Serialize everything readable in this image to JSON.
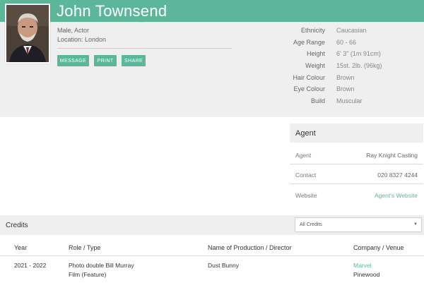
{
  "profile": {
    "name": "John Townsend",
    "gender_role": "Male, Actor",
    "location": "Location: London",
    "buttons": {
      "message": "MESSAGE",
      "print": "PRINT",
      "share": "SHARE"
    },
    "attributes": [
      {
        "label": "Ethnicity",
        "value": "Caucasian"
      },
      {
        "label": "Age Range",
        "value": "60 - 66"
      },
      {
        "label": "Height",
        "value": "6' 3\" (1m 91cm)"
      },
      {
        "label": "Weight",
        "value": "15st. 2lb. (96kg)"
      },
      {
        "label": "Hair Colour",
        "value": "Brown"
      },
      {
        "label": "Eye Colour",
        "value": "Brown"
      },
      {
        "label": "Build",
        "value": "Muscular"
      }
    ]
  },
  "agent": {
    "title": "Agent",
    "rows": [
      {
        "label": "Agent",
        "value": "Ray Knight Casting"
      },
      {
        "label": "Contact",
        "value": "020 8327 4244"
      },
      {
        "label": "Website",
        "value": "Agent's Website"
      }
    ]
  },
  "credits": {
    "title": "Credits",
    "filter_selected": "All Credits",
    "columns": [
      "Year",
      "Role / Type",
      "Name of Production / Director",
      "Company / Venue"
    ],
    "rows": [
      {
        "year": "2021 - 2022",
        "role": "Photo double Bill Murray",
        "type": "Film (Feature)",
        "production": "Dust Bunny",
        "company": "Marvel",
        "venue": "Pinewood"
      }
    ]
  },
  "colors": {
    "accent": "#5cb699",
    "panel": "#efefef"
  },
  "icons": {
    "select_caret": "chevron-down-icon"
  }
}
